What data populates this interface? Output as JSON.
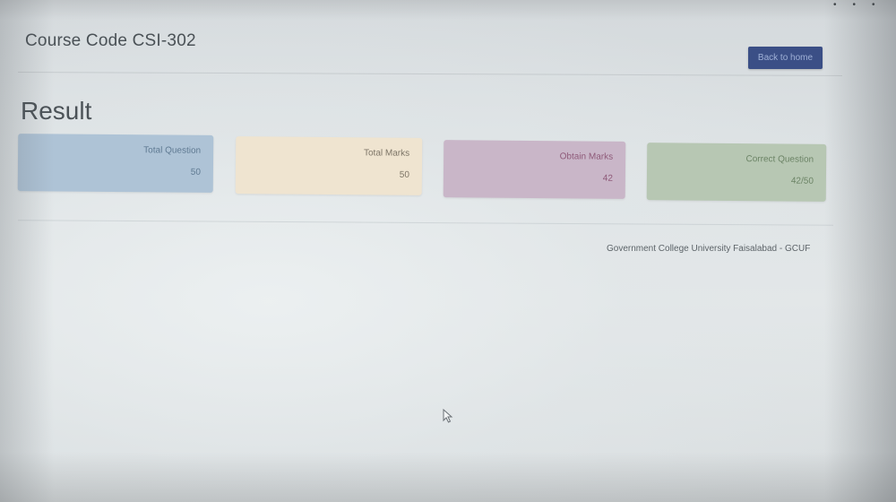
{
  "header": {
    "title": "Course Code CSI-302",
    "back_button_label": "Back to home"
  },
  "page": {
    "heading": "Result"
  },
  "cards": [
    {
      "label": "Total Question",
      "value": "50",
      "color": "#aec3d6"
    },
    {
      "label": "Total Marks",
      "value": "50",
      "color": "#efe4d0"
    },
    {
      "label": "Obtain Marks",
      "value": "42",
      "color": "#c9b6c8"
    },
    {
      "label": "Correct Question",
      "value": "42/50",
      "color": "#b7c7b3"
    }
  ],
  "footer": {
    "text": "Government College University Faisalabad - GCUF"
  },
  "colors": {
    "accent_button": "#3b4f86"
  }
}
